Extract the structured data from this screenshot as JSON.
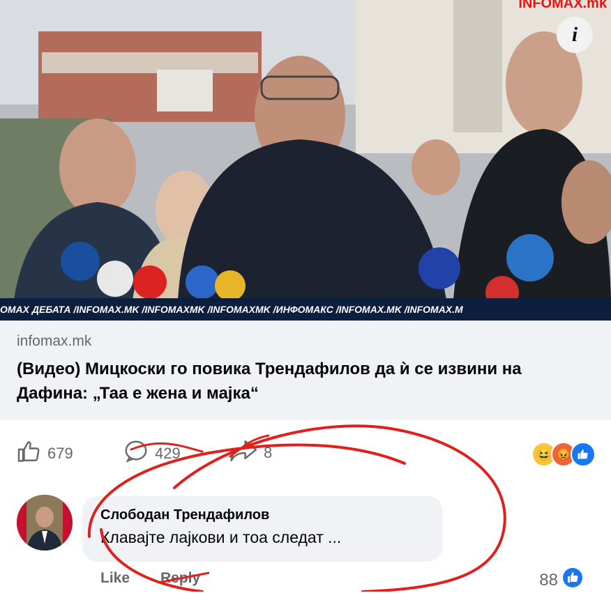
{
  "post": {
    "source_domain": "infomax.mk",
    "headline": "(Видео) Мицкоски го повика Трендафилов да ѝ се извини на Дафина: „Таа е жена и мајка“",
    "ticker": "ОМАХ ДЕБАТА  /INFOMAX.MK  /INFOMAXMK  /INFOMAXMK  /ИНФОМАКС  /INFOMAX.MK  /INFOMAX.M",
    "logo_text": "INFOMAX.mk",
    "info_glyph": "i",
    "likes": "679",
    "comments": "429",
    "shares": "8",
    "reactions": [
      "haha-icon",
      "angry-icon",
      "like-icon"
    ]
  },
  "comment": {
    "author": "Слободан Трендафилов",
    "text": "Клавајте лајкови и тоа следат ...",
    "like_label": "Like",
    "reply_label": "Reply",
    "like_count": "88"
  },
  "colors": {
    "facebook_blue": "#1877f2",
    "annotation_red": "#e0201c",
    "ticker_bg": "#0c1f3f"
  }
}
